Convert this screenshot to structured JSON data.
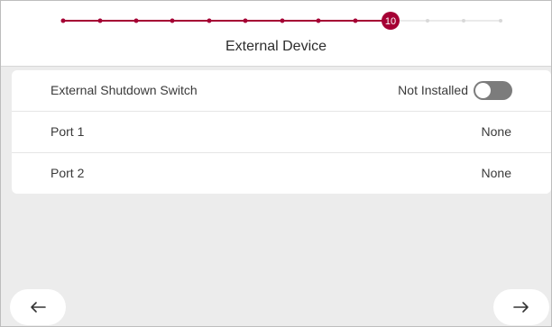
{
  "stepper": {
    "current_step": "10",
    "completed_color": "#a50034",
    "pending_color": "#d8d8d8"
  },
  "page": {
    "title": "External Device"
  },
  "settings": [
    {
      "label": "External Shutdown Switch",
      "value": "Not Installed",
      "toggle": false
    },
    {
      "label": "Port 1",
      "value": "None"
    },
    {
      "label": "Port 2",
      "value": "None"
    }
  ],
  "nav": {
    "back_icon": "arrow-left-icon",
    "next_icon": "arrow-right-icon"
  }
}
